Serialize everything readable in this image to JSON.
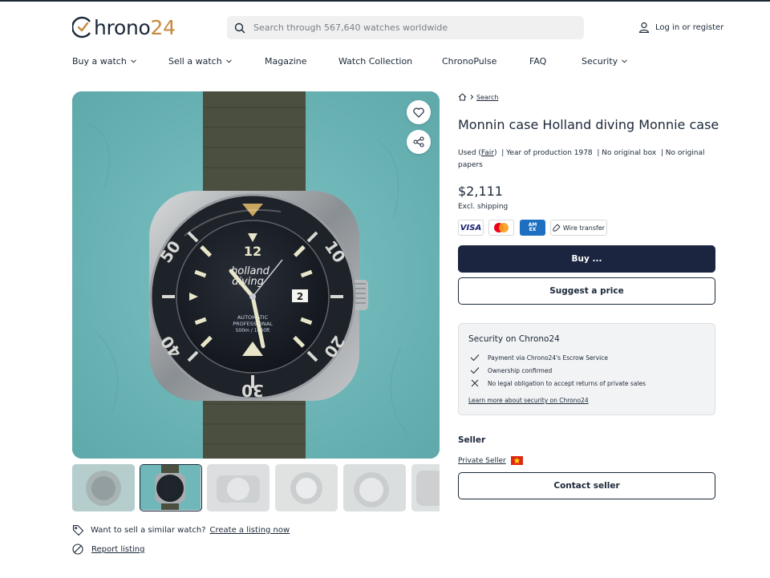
{
  "header": {
    "logo_text": "hrono",
    "logo_number": "24",
    "search_placeholder": "Search through 567,640 watches worldwide",
    "login_label": "Log in or register"
  },
  "nav": {
    "items": [
      {
        "label": "Buy a watch",
        "dropdown": true
      },
      {
        "label": "Sell a watch",
        "dropdown": true
      },
      {
        "label": "Magazine",
        "dropdown": false
      },
      {
        "label": "Watch Collection",
        "dropdown": false
      },
      {
        "label": "ChronoPulse",
        "dropdown": false
      },
      {
        "label": "FAQ",
        "dropdown": false
      },
      {
        "label": "Security",
        "dropdown": true
      }
    ]
  },
  "gallery": {
    "thumbnail_count": 6,
    "active_thumbnail": 2,
    "dial_brand_line1": "holland",
    "dial_brand_line2": "diving",
    "dial_text_1": "AUTOMATIC",
    "dial_text_2": "PROFESSIONAL",
    "dial_text_3": "500m / 1640ft",
    "dial_date": "2",
    "bezel_numbers": [
      "50",
      "10",
      "40",
      "20",
      "30"
    ],
    "dial_numeral": "12"
  },
  "sell_similar": {
    "text": "Want to sell a similar watch?",
    "link": "Create a listing now"
  },
  "report": {
    "link": "Report listing"
  },
  "product": {
    "breadcrumb": [
      "Search"
    ],
    "title": "Monnin case Holland diving Monnie case",
    "condition_prefix": "Used (",
    "condition_link": "Fair",
    "condition_suffix": ")",
    "meta_rest": "  | Year of production 1978  | No original box  | No original papers",
    "price": "$2,111",
    "shipping": "Excl. shipping",
    "payments": {
      "visa": "VISA",
      "amex": "AM EX",
      "wire": "Wire transfer"
    },
    "buy_label": "Buy ...",
    "suggest_label": "Suggest a price"
  },
  "security": {
    "title": "Security on Chrono24",
    "items": [
      {
        "icon": "check-icon",
        "text": "Payment via Chrono24's Escrow Service"
      },
      {
        "icon": "check-icon",
        "text": "Ownership confirmed"
      },
      {
        "icon": "close-icon",
        "text": "No legal obligation to accept returns of private sales"
      }
    ],
    "link": "Learn more about security on Chrono24"
  },
  "seller": {
    "heading": "Seller",
    "name": "Private Seller",
    "flag": "cn-flag-icon",
    "contact_label": "Contact seller"
  },
  "colors": {
    "navy": "#1b2540",
    "brand_gold": "#c6893f",
    "amex_blue": "#1c6fc1",
    "backdrop_teal": "#6fb7b9"
  }
}
